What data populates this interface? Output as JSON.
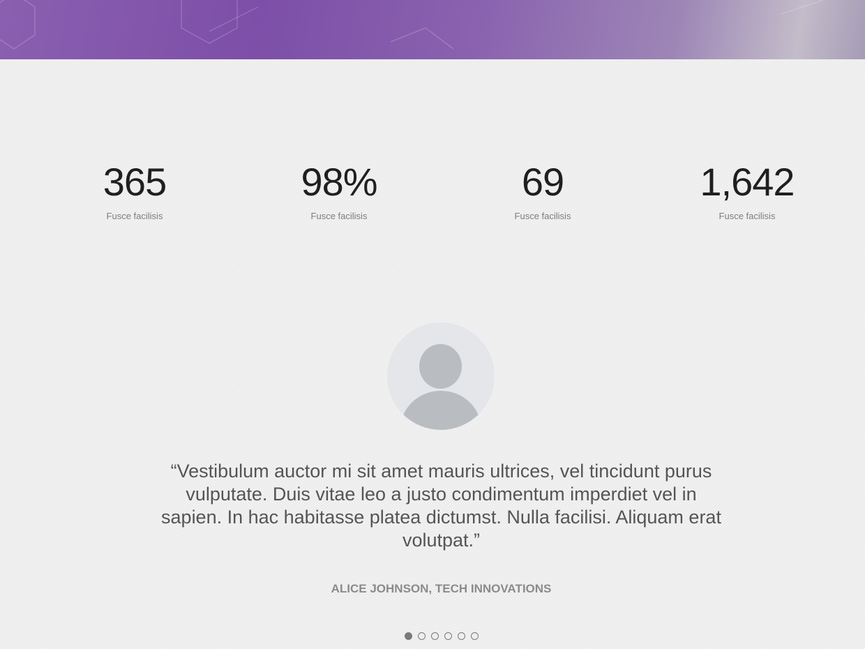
{
  "stats": [
    {
      "value": "365",
      "label": "Fusce facilisis"
    },
    {
      "value": "98%",
      "label": "Fusce facilisis"
    },
    {
      "value": "69",
      "label": "Fusce facilisis"
    },
    {
      "value": "1,642",
      "label": "Fusce facilisis"
    }
  ],
  "testimonial": {
    "avatar_icon": "user-avatar-placeholder-icon",
    "quote": "“Vestibulum auctor mi sit amet mauris ultrices, vel tincidunt purus vulputate. Duis vitae leo a justo condimentum imperdiet vel in sapien. In hac habitasse platea dictumst. Nulla facilisi. Aliquam erat volutpat.”",
    "author": "ALICE JOHNSON, TECH INNOVATIONS"
  },
  "pager": {
    "total": 6,
    "active_index": 0
  },
  "colors": {
    "banner_purple": "#7d4fa8",
    "text_dark": "#1f1f1f",
    "text_muted": "#7d7d7d",
    "avatar_bg": "#e4e6ea",
    "avatar_fg": "#b9bdc2"
  }
}
